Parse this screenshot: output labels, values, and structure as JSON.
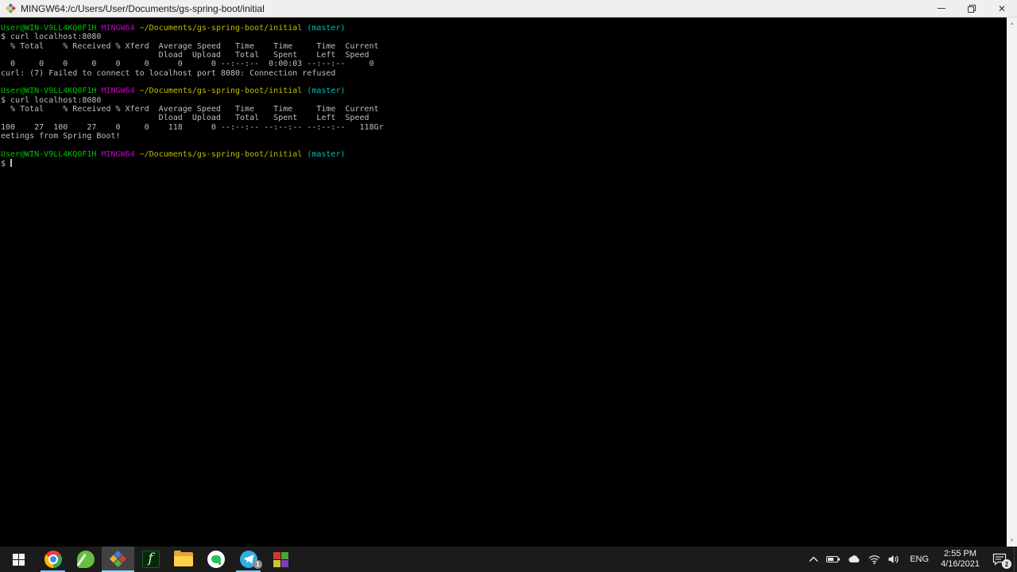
{
  "window": {
    "title": "MINGW64:/c/Users/User/Documents/gs-spring-boot/initial"
  },
  "colors": {
    "terminal_bg": "#000000",
    "terminal_fg": "#bfbfbf",
    "ansi_green": "#00c200",
    "ansi_magenta": "#bf00bf",
    "ansi_yellow": "#bfbf00",
    "ansi_cyan": "#00bfbf",
    "taskbar_bg": "#1b1b1b",
    "accent_underline": "#7fc4f5",
    "titlebar_bg": "#f1efee"
  },
  "terminal": {
    "lines": [
      {
        "segments": [
          {
            "t": "User@WIN-V9LL4KQ0F1H ",
            "c": "green"
          },
          {
            "t": "MINGW64 ",
            "c": "magenta"
          },
          {
            "t": "~/Documents/gs-spring-boot/initial ",
            "c": "yellow"
          },
          {
            "t": "(master)",
            "c": "cyan"
          }
        ]
      },
      {
        "segments": [
          {
            "t": "$ curl localhost:8080",
            "c": "fg"
          }
        ]
      },
      {
        "segments": [
          {
            "t": "  % Total    % Received % Xferd  Average Speed   Time    Time     Time  Current",
            "c": "fg"
          }
        ]
      },
      {
        "segments": [
          {
            "t": "                                 Dload  Upload   Total   Spent    Left  Speed",
            "c": "fg"
          }
        ]
      },
      {
        "segments": [
          {
            "t": "  0     0    0     0    0     0      0      0 --:--:--  0:00:03 --:--:--     0",
            "c": "fg"
          }
        ]
      },
      {
        "segments": [
          {
            "t": "curl: (7) Failed to connect to localhost port 8080: Connection refused",
            "c": "fg"
          }
        ]
      },
      {
        "segments": []
      },
      {
        "segments": [
          {
            "t": "User@WIN-V9LL4KQ0F1H ",
            "c": "green"
          },
          {
            "t": "MINGW64 ",
            "c": "magenta"
          },
          {
            "t": "~/Documents/gs-spring-boot/initial ",
            "c": "yellow"
          },
          {
            "t": "(master)",
            "c": "cyan"
          }
        ]
      },
      {
        "segments": [
          {
            "t": "$ curl localhost:8080",
            "c": "fg"
          }
        ]
      },
      {
        "segments": [
          {
            "t": "  % Total    % Received % Xferd  Average Speed   Time    Time     Time  Current",
            "c": "fg"
          }
        ]
      },
      {
        "segments": [
          {
            "t": "                                 Dload  Upload   Total   Spent    Left  Speed",
            "c": "fg"
          }
        ]
      },
      {
        "segments": [
          {
            "t": "100    27  100    27    0     0    118      0 --:--:-- --:--:-- --:--:--   118Gr",
            "c": "fg"
          }
        ]
      },
      {
        "segments": [
          {
            "t": "eetings from Spring Boot!",
            "c": "fg"
          }
        ]
      },
      {
        "segments": []
      },
      {
        "segments": [
          {
            "t": "User@WIN-V9LL4KQ0F1H ",
            "c": "green"
          },
          {
            "t": "MINGW64 ",
            "c": "magenta"
          },
          {
            "t": "~/Documents/gs-spring-boot/initial ",
            "c": "yellow"
          },
          {
            "t": "(master)",
            "c": "cyan"
          }
        ]
      },
      {
        "segments": [
          {
            "t": "$ ",
            "c": "fg"
          }
        ],
        "cursor": true
      }
    ]
  },
  "taskbar": {
    "telegram_badge": "1"
  },
  "tray": {
    "language": "ENG",
    "time": "2:55 PM",
    "date": "4/16/2021",
    "notification_badge": "2"
  }
}
